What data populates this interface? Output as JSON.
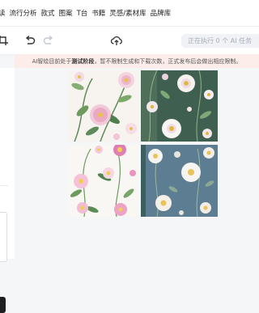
{
  "top_nav": {
    "items": [
      "读",
      "流行分析",
      "款式",
      "图案",
      "T台",
      "书籍",
      "灵感/素材库",
      "品牌库"
    ]
  },
  "toolbar": {
    "crop_icon": "crop-icon",
    "undo_icon": "undo-icon",
    "redo_icon": "redo-icon",
    "upload_icon": "cloud-upload-icon",
    "status_text": "正在执行 0 个 AI 任务"
  },
  "notice": {
    "prefix": "AI智绘目前处于",
    "highlight": "测试阶段",
    "suffix": "，暂不限制生成和下载次数，正式发布后会做出相应限制。"
  },
  "canvas": {
    "images": [
      {
        "name": "pink-cosmos-white-background",
        "background": "#f7f4ef"
      },
      {
        "name": "white-daisies-green-background",
        "background": "#3f5f50"
      },
      {
        "name": "pink-wildflowers-white-background",
        "background": "#f8f7f3"
      },
      {
        "name": "white-flowers-blue-background",
        "background": "#5d7e92"
      }
    ]
  },
  "colors": {
    "notice_bg": "#fcecea",
    "status_pill_bg": "#f0f2f5",
    "page_bg": "#f5f6f8"
  }
}
